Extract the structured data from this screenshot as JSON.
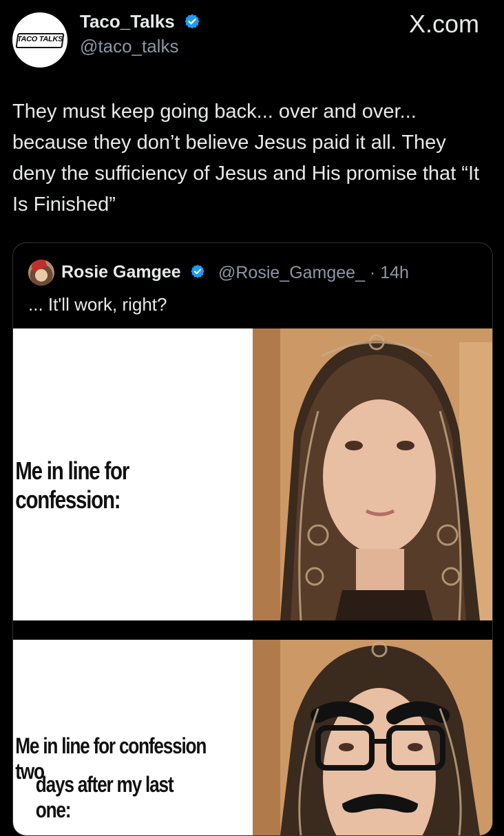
{
  "author": {
    "display_name": "Taco_Talks",
    "handle": "@taco_talks",
    "avatar_text": "TACO TALKS"
  },
  "site_label": "X.com",
  "tweet_text": "They must keep going back... over and over... because they don’t believe Jesus paid it all. They deny the sufficiency of Jesus and His promise that “It Is Finished”",
  "quote": {
    "display_name": "Rosie Gamgee",
    "handle_time": "@Rosie_Gamgee_ · 14h",
    "text": "... It'll work, right?",
    "meme": {
      "panel1_caption": "Me in line for confession:",
      "panel2_caption_line1": "Me in line for confession two",
      "panel2_caption_line2": "days after my last one:"
    }
  },
  "colors": {
    "background": "#000000",
    "text": "#e7e9ea",
    "secondary_text": "#8b98a5",
    "verified": "#1d9bf0",
    "border": "#2f3336"
  }
}
